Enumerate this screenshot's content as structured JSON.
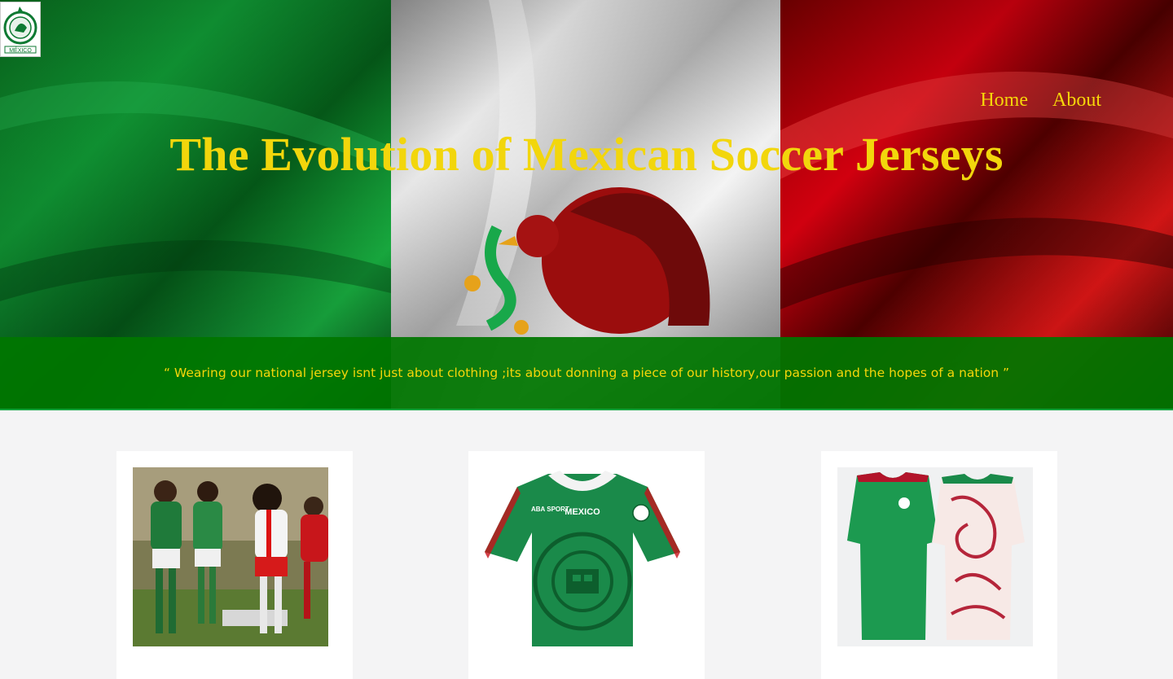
{
  "nav": {
    "home": "Home",
    "about": "About"
  },
  "hero": {
    "title": "The Evolution of Mexican Soccer Jerseys",
    "quote": "“ Wearing our national jersey isnt just about clothing ;its about donning a piece of our history,our passion and the hopes of a nation ”"
  },
  "logo": {
    "text": "MÉXICO",
    "icon": "mexico-federation-crest-icon"
  },
  "cards": [
    {
      "image": "vintage-match-photo",
      "jersey_text": ""
    },
    {
      "image": "retro-aztec-jersey",
      "jersey_text": "MEXICO",
      "brand": "ABA SPORT"
    },
    {
      "image": "modern-home-away-jerseys"
    }
  ],
  "colors": {
    "accent": "#f2d60c",
    "green": "#007600",
    "red": "#c8000a",
    "background": "#f4f4f5"
  }
}
